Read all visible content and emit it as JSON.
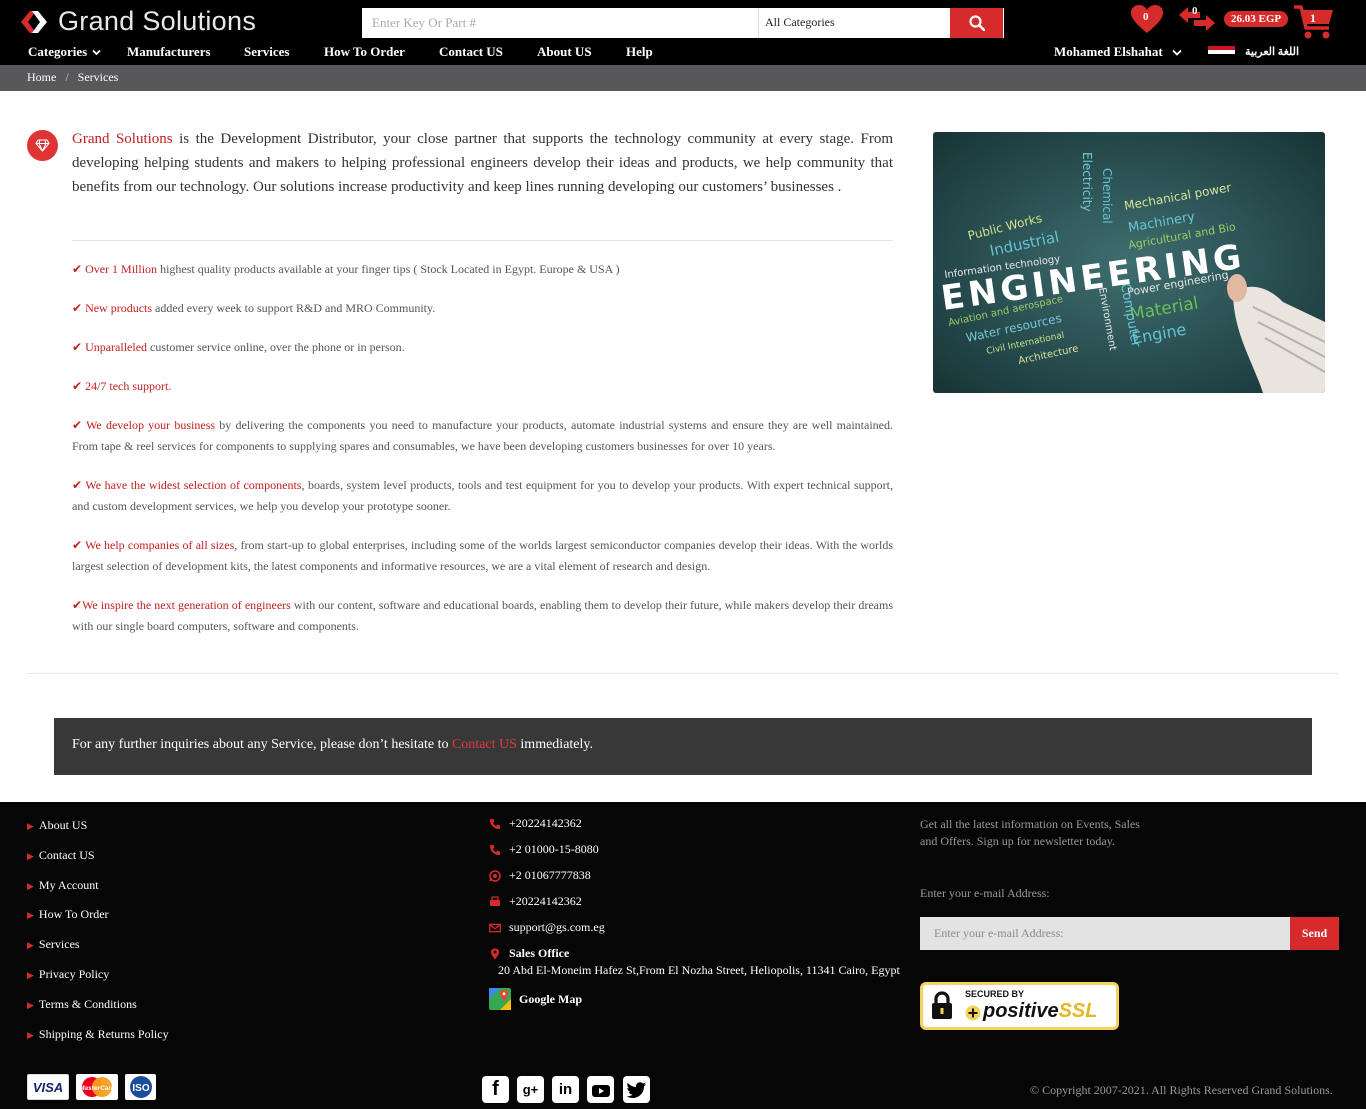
{
  "header": {
    "logo_text": "Grand Solutions",
    "search_placeholder": "Enter Key Or Part #",
    "category_selected": "All Categories",
    "wishlist_count": "0",
    "compare_count": "0",
    "balance": "26.03 EGP",
    "cart_count": "1",
    "user_name": "Mohamed Elshahat",
    "language_label": "اللغة العربية"
  },
  "nav": {
    "items": [
      "Categories",
      "Manufacturers",
      "Services",
      "How To Order",
      "Contact US",
      "About US",
      "Help"
    ]
  },
  "breadcrumb": {
    "home": "Home",
    "separator": "/",
    "current": "Services"
  },
  "intro": {
    "brand": "Grand Solutions",
    "text": " is the Development Distributor, your close partner that supports the technology community at every stage. From developing helping students and makers to helping professional engineers develop their ideas and products, we help community that benefits from our technology. Our solutions increase productivity and keep lines running developing our customers’ businesses ."
  },
  "features": [
    {
      "highlight": "Over 1 Million",
      "text": " highest quality products available at your finger tips ( Stock Located in Egypt. Europe & USA )"
    },
    {
      "highlight": "New products",
      "text": " added every week to support R&D and MRO Community."
    },
    {
      "highlight": "Unparalleled",
      "text": " customer service online, over the phone or in person."
    },
    {
      "highlight": "24/7 tech support.",
      "text": ""
    },
    {
      "highlight": "We develop your business",
      "text": " by delivering the components you need to manufacture your products, automate industrial systems and ensure they are well maintained. From tape & reel services for components to supplying spares and consumables, we have been developing customers businesses for over 10 years."
    },
    {
      "highlight": "We have the widest selection of components",
      "text": ", boards, system level products, tools and test equipment for you to develop your products. With expert technical support, and custom development services, we help you develop your prototype sooner."
    },
    {
      "highlight": "We help companies of all sizes",
      "text": ", from start-up to global enterprises, including some of the worlds largest semiconductor companies develop their ideas. With the worlds largest selection of development kits, the latest components and informative resources, we are a vital element of research and design."
    },
    {
      "highlight": "We inspire the next generation of engineers",
      "text": " with our content, software and educational boards, enabling them to develop their future, while makers develop their dreams with our single board computers, software and components."
    }
  ],
  "image_words": {
    "main": "ENGINEERING",
    "words": [
      "Mechanical power",
      "Machinery",
      "Agricultural and Bio",
      "Public Works",
      "Industrial",
      "Information technology",
      "Electricity",
      "Chemical",
      "Power engineering",
      "Material",
      "Engine",
      "Aviation and aerospace",
      "Water resources",
      "Civil International",
      "Architecture",
      "Computer",
      "Environment"
    ]
  },
  "cta": {
    "before": "For any further inquiries about any Service, please don’t hesitate to ",
    "link": "Contact US",
    "after": " immediately."
  },
  "footer": {
    "links": [
      "About US",
      "Contact US",
      "My Account",
      "How To Order",
      "Services",
      "Privacy Policy",
      "Terms & Conditions",
      "Shipping & Returns Policy"
    ],
    "phone1": "+20224142362",
    "phone2": "+2 01000-15-8080",
    "whatsapp": "+2 01067777838",
    "fax": "+20224142362",
    "email": "support@gs.com.eg",
    "office_title": "Sales Office",
    "office_address": "20 Abd El-Moneim Hafez St,From El Nozha Street, Heliopolis, 11341 Cairo, Egypt",
    "map_label": "Google Map",
    "newsletter_text": "Get all the latest information on Events, Sales and Offers. Sign up for newsletter today.",
    "email_label": "Enter your e-mail Address:",
    "email_placeholder": "Enter your e-mail Address:",
    "send_label": "Send",
    "ssl_top": "SECURED BY",
    "ssl_brand": "positive",
    "ssl_suffix": "SSL",
    "payment": [
      "VISA",
      "MasterCard",
      "ISO"
    ],
    "social": [
      "facebook-icon",
      "google-plus-icon",
      "linkedin-icon",
      "youtube-icon",
      "twitter-icon"
    ],
    "copyright": "© Copyright 2007-2021. All Rights Reserved Grand Solutions."
  },
  "colors": {
    "accent": "#d52b2b",
    "header_bg": "#000000",
    "breadcrumb_bg": "#58585a",
    "cta_bg": "#383838"
  }
}
